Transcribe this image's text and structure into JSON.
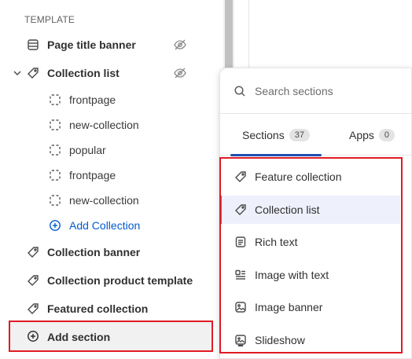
{
  "template": {
    "section_label": "TEMPLATE",
    "items": [
      {
        "label": "Page title banner",
        "icon": "layout-icon"
      },
      {
        "label": "Collection list",
        "icon": "tag-icon",
        "expanded": true,
        "children": [
          {
            "label": "frontpage"
          },
          {
            "label": "new-collection"
          },
          {
            "label": "popular"
          },
          {
            "label": "frontpage"
          },
          {
            "label": "new-collection"
          }
        ],
        "add_child_label": "Add Collection"
      },
      {
        "label": "Collection banner",
        "icon": "tag-icon"
      },
      {
        "label": "Collection product template",
        "icon": "tag-icon"
      },
      {
        "label": "Featured collection",
        "icon": "tag-icon"
      }
    ],
    "add_section_label": "Add section"
  },
  "popover": {
    "search_placeholder": "Search sections",
    "tabs": [
      {
        "label": "Sections",
        "count": "37",
        "active": true
      },
      {
        "label": "Apps",
        "count": "0",
        "active": false
      }
    ],
    "sections": [
      {
        "label": "Feature collection",
        "icon": "tag-icon"
      },
      {
        "label": "Collection list",
        "icon": "tag-icon",
        "selected": true
      },
      {
        "label": "Rich text",
        "icon": "text-block-icon"
      },
      {
        "label": "Image with text",
        "icon": "image-with-text-icon"
      },
      {
        "label": "Image banner",
        "icon": "image-icon"
      },
      {
        "label": "Slideshow",
        "icon": "slideshow-icon"
      }
    ]
  },
  "colors": {
    "accent_blue": "#005bd3",
    "tab_underline": "#1f4fb3",
    "highlight_red": "#e01b24",
    "selected_bg": "#eef1fb"
  }
}
